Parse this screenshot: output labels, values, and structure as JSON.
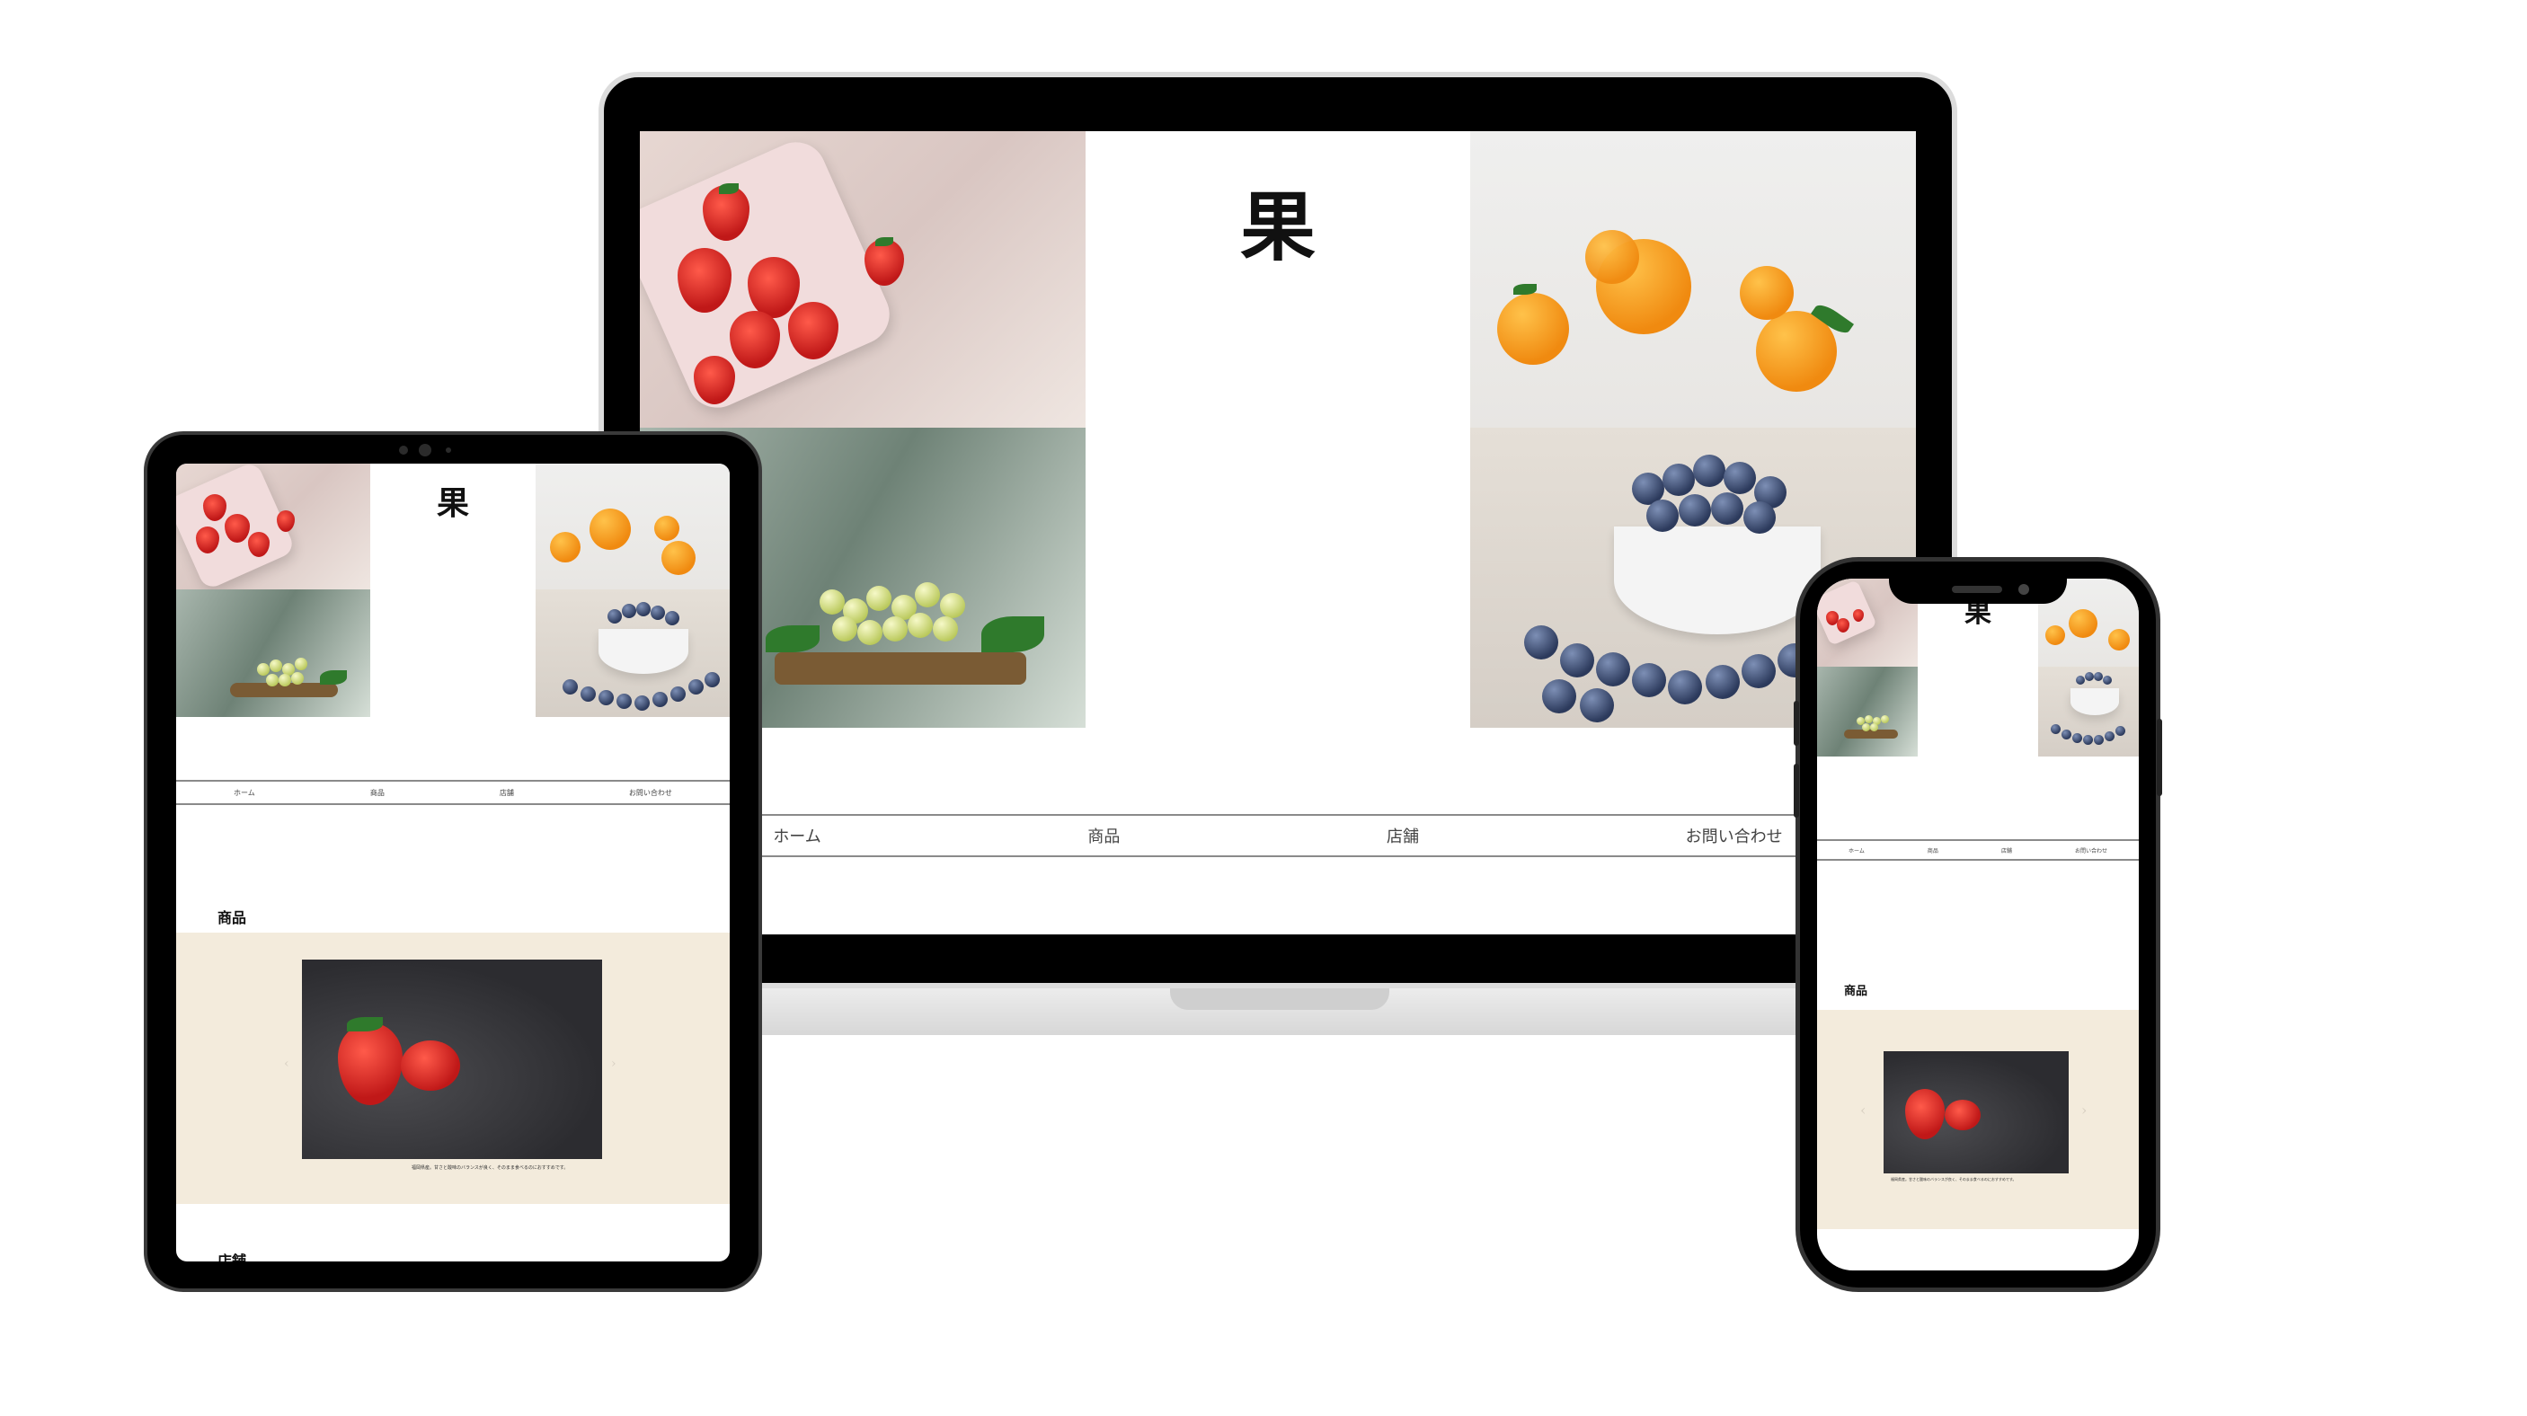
{
  "site": {
    "logo": "果",
    "nav": [
      "ホーム",
      "商品",
      "店舗",
      "お問い合わせ"
    ],
    "products_heading": "商品",
    "product_caption": "福岡県産。甘さと酸味のバランスが良く、そのまま食べるのにおすすめです。",
    "stores_heading": "店舗"
  },
  "icons": {
    "prev": "chevron-left-icon",
    "next": "chevron-right-icon"
  },
  "colors": {
    "product_band": "#f3ebdc",
    "device_frame": "#000000",
    "nav_rule": "#8a8a8a"
  }
}
